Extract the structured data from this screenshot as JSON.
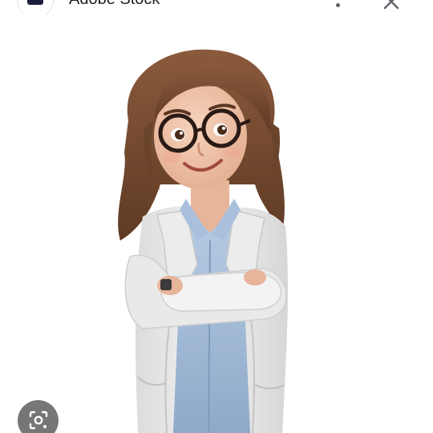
{
  "header": {
    "source_name": "Adobe Stock",
    "favicon_icon": "adobe-stock-logo-icon",
    "more_icon": "more-vert-icon",
    "close_icon": "close-icon"
  },
  "image": {
    "subject_icon": "cartoon-doctor-illustration"
  },
  "lens": {
    "icon": "lens-icon"
  },
  "colors": {
    "background": "#ffffff",
    "lens_button": "#6b6b6b",
    "text": "#202124"
  }
}
